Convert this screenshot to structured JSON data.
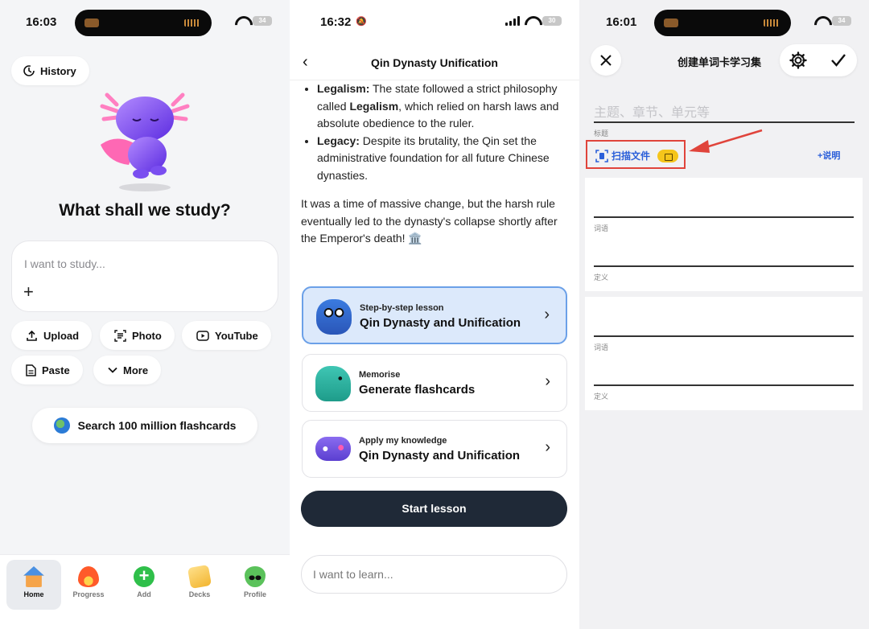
{
  "panel1": {
    "time": "16:03",
    "battery": "34",
    "history_label": "History",
    "headline": "What shall we study?",
    "study_placeholder": "I want to study...",
    "plus": "+",
    "chips": {
      "upload": "Upload",
      "photo": "Photo",
      "youtube": "YouTube",
      "paste": "Paste",
      "more": "More"
    },
    "search_label": "Search 100 million flashcards",
    "tabs": {
      "home": "Home",
      "progress": "Progress",
      "add": "Add",
      "decks": "Decks",
      "profile": "Profile"
    }
  },
  "panel2": {
    "time": "16:32",
    "battery": "30",
    "title": "Qin Dynasty Unification",
    "bullet1_term": "Legalism:",
    "bullet1_a": " The state followed a strict philosophy called ",
    "bullet1_strong": "Legalism",
    "bullet1_b": ", which relied on harsh laws and absolute obedience to the ruler.",
    "bullet2_term": "Legacy:",
    "bullet2_text": " Despite its brutality, the Qin set the administrative foundation for all future Chinese dynasties.",
    "paragraph": "It was a time of massive change, but the harsh rule eventually led to the dynasty's collapse shortly after the Emperor's death! 🏛️",
    "cards": [
      {
        "small": "Step-by-step lesson",
        "big": "Qin Dynasty and Unification"
      },
      {
        "small": "Memorise",
        "big": "Generate flashcards"
      },
      {
        "small": "Apply my knowledge",
        "big": "Qin Dynasty and Unification"
      }
    ],
    "start_label": "Start lesson",
    "learn_placeholder": "I want to learn..."
  },
  "panel3": {
    "time": "16:01",
    "battery": "34",
    "title": "创建单词卡学习集",
    "title_placeholder": "主题、章节、单元等",
    "title_label": "标题",
    "scan_label": "扫描文件",
    "explain_label": "+说明",
    "term_label": "词语",
    "definition_label": "定义"
  },
  "colors": {
    "accent_blue": "#2b5fd9",
    "dark_button": "#1f2937",
    "highlight_red": "#e0443b",
    "selected_card": "#dce9fb"
  }
}
